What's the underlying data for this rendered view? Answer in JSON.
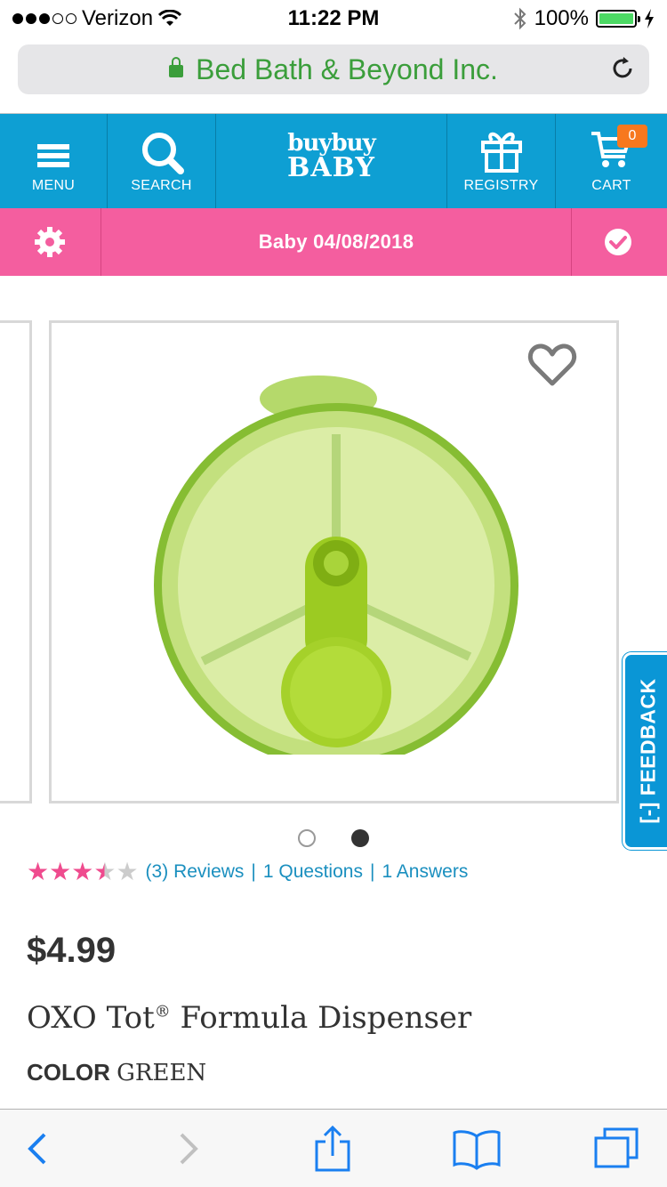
{
  "status": {
    "carrier": "Verizon",
    "time": "11:22 PM",
    "battery": "100%"
  },
  "browser": {
    "url_title": "Bed Bath & Beyond Inc."
  },
  "nav": {
    "menu": "MENU",
    "search": "SEARCH",
    "logo_line1": "buybuy",
    "logo_line2": "BABY",
    "registry": "REGISTRY",
    "cart": "CART",
    "cart_count": "0"
  },
  "registry": {
    "label": "Baby 04/08/2018"
  },
  "product": {
    "rating": 3.5,
    "rating_max": 5,
    "review_count": "(3)",
    "reviews_label": "Reviews",
    "questions_label": "1 Questions",
    "answers_label": "1 Answers",
    "price": "$4.99",
    "title": "OXO Tot",
    "title_mark": "®",
    "title_rest": " Formula Dispenser",
    "color_label": "COLOR",
    "color_value": "GREEN",
    "carousel_total": 2,
    "carousel_active": 2
  },
  "feedback": {
    "label": "[-] FEEDBACK"
  },
  "colors": {
    "nav_blue": "#0e9fd3",
    "registry_pink": "#f45e9f",
    "star_pink": "#ef4b8e",
    "link_blue": "#1a8fbf",
    "cart_orange": "#f7781e",
    "secure_green": "#3b9e3b"
  }
}
